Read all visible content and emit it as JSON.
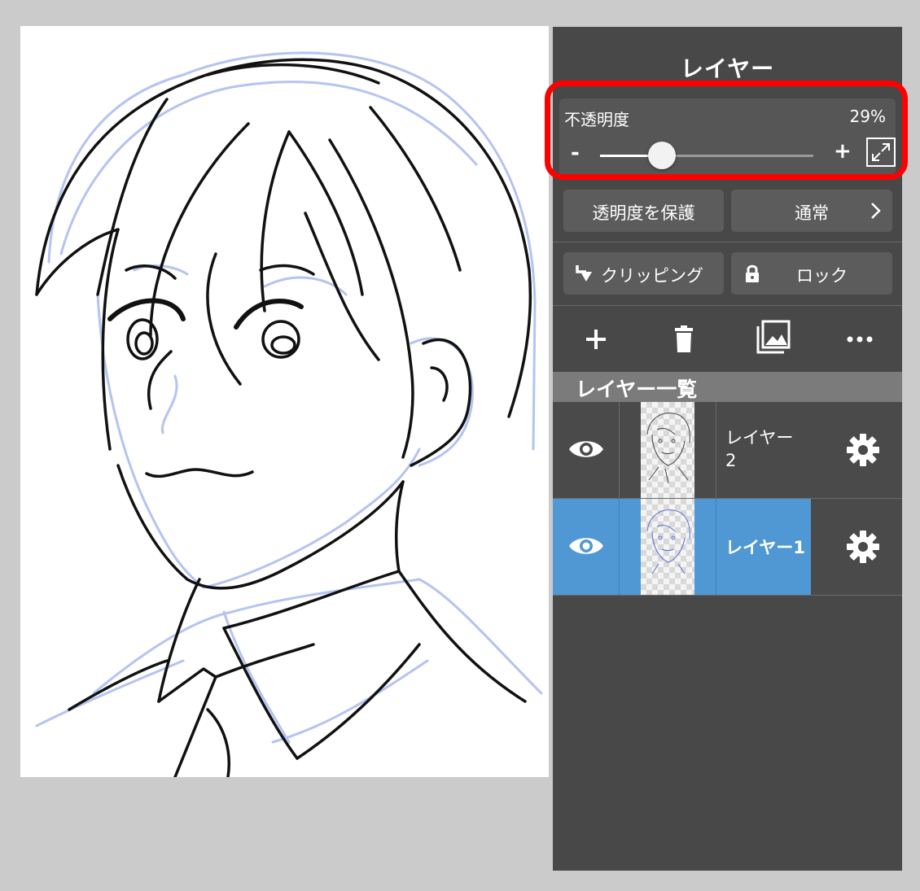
{
  "panel": {
    "title": "レイヤー",
    "opacity": {
      "label": "不透明度",
      "value_text": "29%",
      "value": 0.29,
      "minus": "-",
      "plus": "+"
    },
    "buttons": {
      "protect_alpha": "透明度を保護",
      "blend_mode": "通常",
      "clipping": "クリッピング",
      "lock": "ロック"
    },
    "toolbar_icons": [
      "plus-icon",
      "trash-icon",
      "layer-gallery-icon",
      "more-icon"
    ],
    "list_header": "レイヤー一覧",
    "layers": [
      {
        "name": "レイヤー\n2",
        "selected": false,
        "visible": true
      },
      {
        "name": "レイヤー1",
        "selected": true,
        "visible": true
      }
    ]
  },
  "colors": {
    "highlight": "#ff0000",
    "selected_layer": "#4f98d3",
    "sketch_lines": "#b4c4f2",
    "panel_bg": "#484848"
  }
}
